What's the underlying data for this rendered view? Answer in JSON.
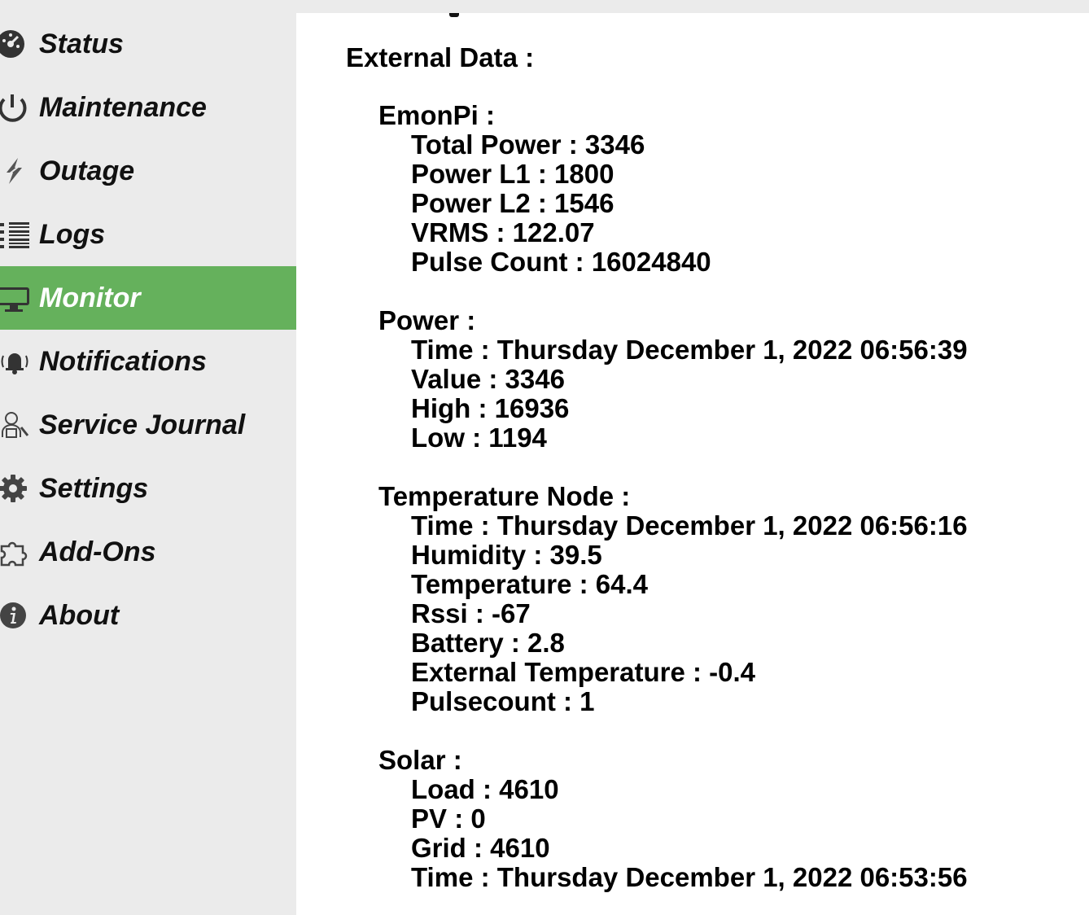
{
  "sidebar": {
    "items": [
      {
        "label": "Status",
        "icon": "speedometer-icon",
        "active": false
      },
      {
        "label": "Maintenance",
        "icon": "power-icon",
        "active": false
      },
      {
        "label": "Outage",
        "icon": "lightning-off-icon",
        "active": false
      },
      {
        "label": "Logs",
        "icon": "list-icon",
        "active": false
      },
      {
        "label": "Monitor",
        "icon": "monitor-icon",
        "active": true
      },
      {
        "label": "Notifications",
        "icon": "bell-icon",
        "active": false
      },
      {
        "label": "Service Journal",
        "icon": "technician-icon",
        "active": false
      },
      {
        "label": "Settings",
        "icon": "gear-icon",
        "active": false
      },
      {
        "label": "Add-Ons",
        "icon": "puzzle-icon",
        "active": false
      },
      {
        "label": "About",
        "icon": "info-icon",
        "active": false
      }
    ],
    "active_color": "#65b15c"
  },
  "main": {
    "title": "External Data :",
    "groups": [
      {
        "title": "EmonPi :",
        "fields": [
          "Total Power : 3346",
          "Power L1 : 1800",
          "Power L2 : 1546",
          "VRMS : 122.07",
          "Pulse Count : 16024840"
        ]
      },
      {
        "title": "Power :",
        "fields": [
          "Time : Thursday December 1, 2022 06:56:39",
          "Value : 3346",
          "High : 16936",
          "Low : 1194"
        ]
      },
      {
        "title": "Temperature Node :",
        "fields": [
          "Time : Thursday December 1, 2022 06:56:16",
          "Humidity : 39.5",
          "Temperature : 64.4",
          "Rssi : -67",
          "Battery : 2.8",
          "External Temperature : -0.4",
          "Pulsecount : 1"
        ]
      },
      {
        "title": "Solar :",
        "fields": [
          "Load : 4610",
          "PV : 0",
          "Grid : 4610",
          "Time : Thursday December 1, 2022 06:53:56"
        ]
      }
    ]
  }
}
